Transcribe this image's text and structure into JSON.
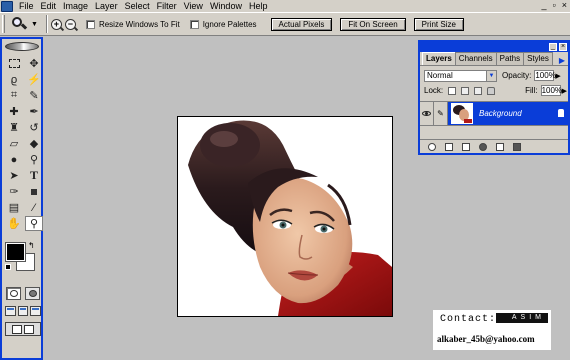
{
  "menubar": {
    "items": [
      "File",
      "Edit",
      "Image",
      "Layer",
      "Select",
      "Filter",
      "View",
      "Window",
      "Help"
    ],
    "window_controls": [
      "_",
      "▫",
      "×"
    ]
  },
  "options_bar": {
    "zoom_in_symbol": "+",
    "zoom_out_symbol": "−",
    "resize_windows_label": "Resize Windows To Fit",
    "resize_windows_checked": false,
    "ignore_palettes_label": "Ignore Palettes",
    "ignore_palettes_checked": false,
    "actual_pixels_label": "Actual Pixels",
    "fit_on_screen_label": "Fit On Screen",
    "print_size_label": "Print Size"
  },
  "toolbox": {
    "foreground_color": "#000000",
    "background_color": "#ffffff",
    "selected_tool": "zoom-tool"
  },
  "layers_panel": {
    "tabs": [
      "Layers",
      "Channels",
      "Paths",
      "Styles"
    ],
    "active_tab": "Layers",
    "blend_mode": "Normal",
    "opacity_label": "Opacity:",
    "opacity_value": "100%",
    "lock_label": "Lock:",
    "fill_label": "Fill:",
    "fill_value": "100%",
    "layer_name": "Background"
  },
  "watermark": {
    "contact_label": "Contact:",
    "logo_text": "ASIM",
    "email": "alkaber_45b@yahoo.com"
  },
  "colors": {
    "accent": "#0a3dd8",
    "workspace": "#c0c0c0",
    "chrome": "#d4d0c8"
  }
}
